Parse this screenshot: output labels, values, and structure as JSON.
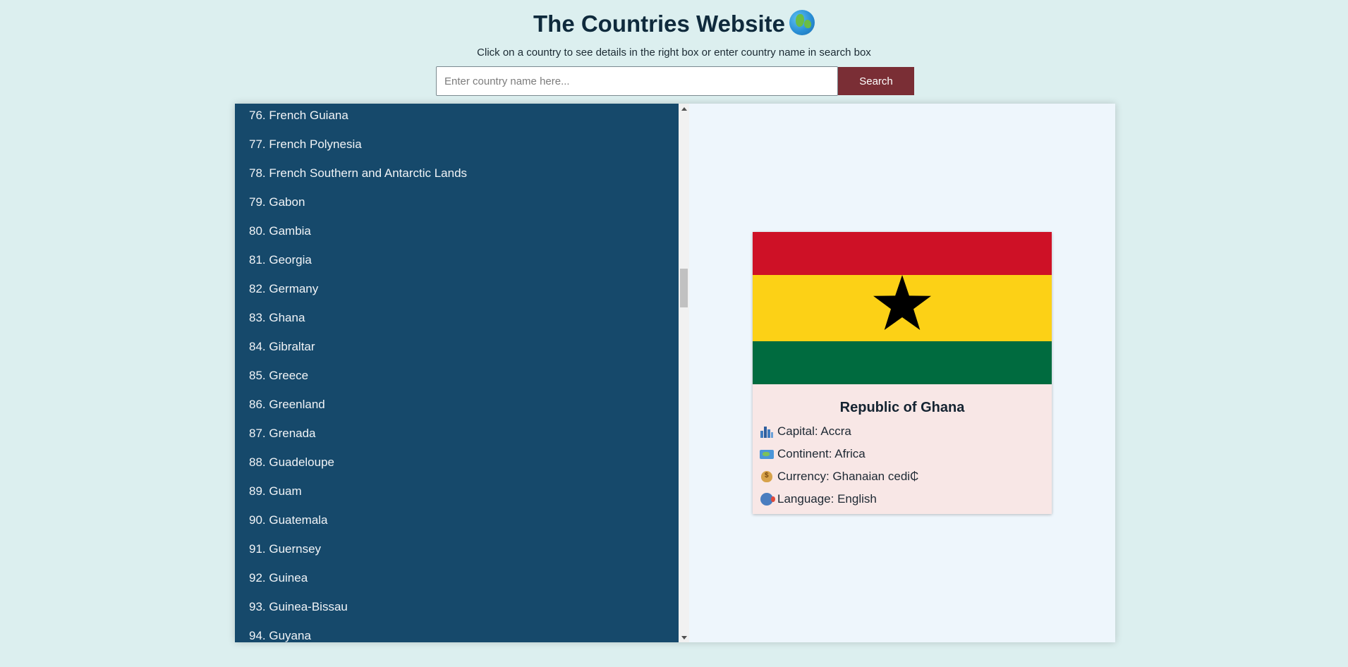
{
  "header": {
    "title": "The Countries Website",
    "title_icon": "globe-icon",
    "subtitle": "Click on a country to see details in the right box or enter country name in search box"
  },
  "search": {
    "placeholder": "Enter country name here...",
    "value": "",
    "button_label": "Search"
  },
  "countries": [
    "76. French Guiana",
    "77. French Polynesia",
    "78. French Southern and Antarctic Lands",
    "79. Gabon",
    "80. Gambia",
    "81. Georgia",
    "82. Germany",
    "83. Ghana",
    "84. Gibraltar",
    "85. Greece",
    "86. Greenland",
    "87. Grenada",
    "88. Guadeloupe",
    "89. Guam",
    "90. Guatemala",
    "91. Guernsey",
    "92. Guinea",
    "93. Guinea-Bissau",
    "94. Guyana"
  ],
  "detail": {
    "official_name": "Republic of Ghana",
    "flag_colors": {
      "red": "#ce1126",
      "yellow": "#fcd116",
      "green": "#006b3f",
      "star": "#000000"
    },
    "items": [
      {
        "icon": "cityscape-icon",
        "text": "Capital: Accra"
      },
      {
        "icon": "world-map-icon",
        "text": "Continent: Africa"
      },
      {
        "icon": "money-bag-icon",
        "text": "Currency: Ghanaian cedi₵"
      },
      {
        "icon": "speaking-head-icon",
        "text": "Language: English"
      }
    ]
  },
  "colors": {
    "page_background": "#dcefef",
    "list_background": "#16496b",
    "detail_background": "#eef6fc",
    "card_background": "#f8e7e6",
    "search_button": "#7a2e35"
  }
}
